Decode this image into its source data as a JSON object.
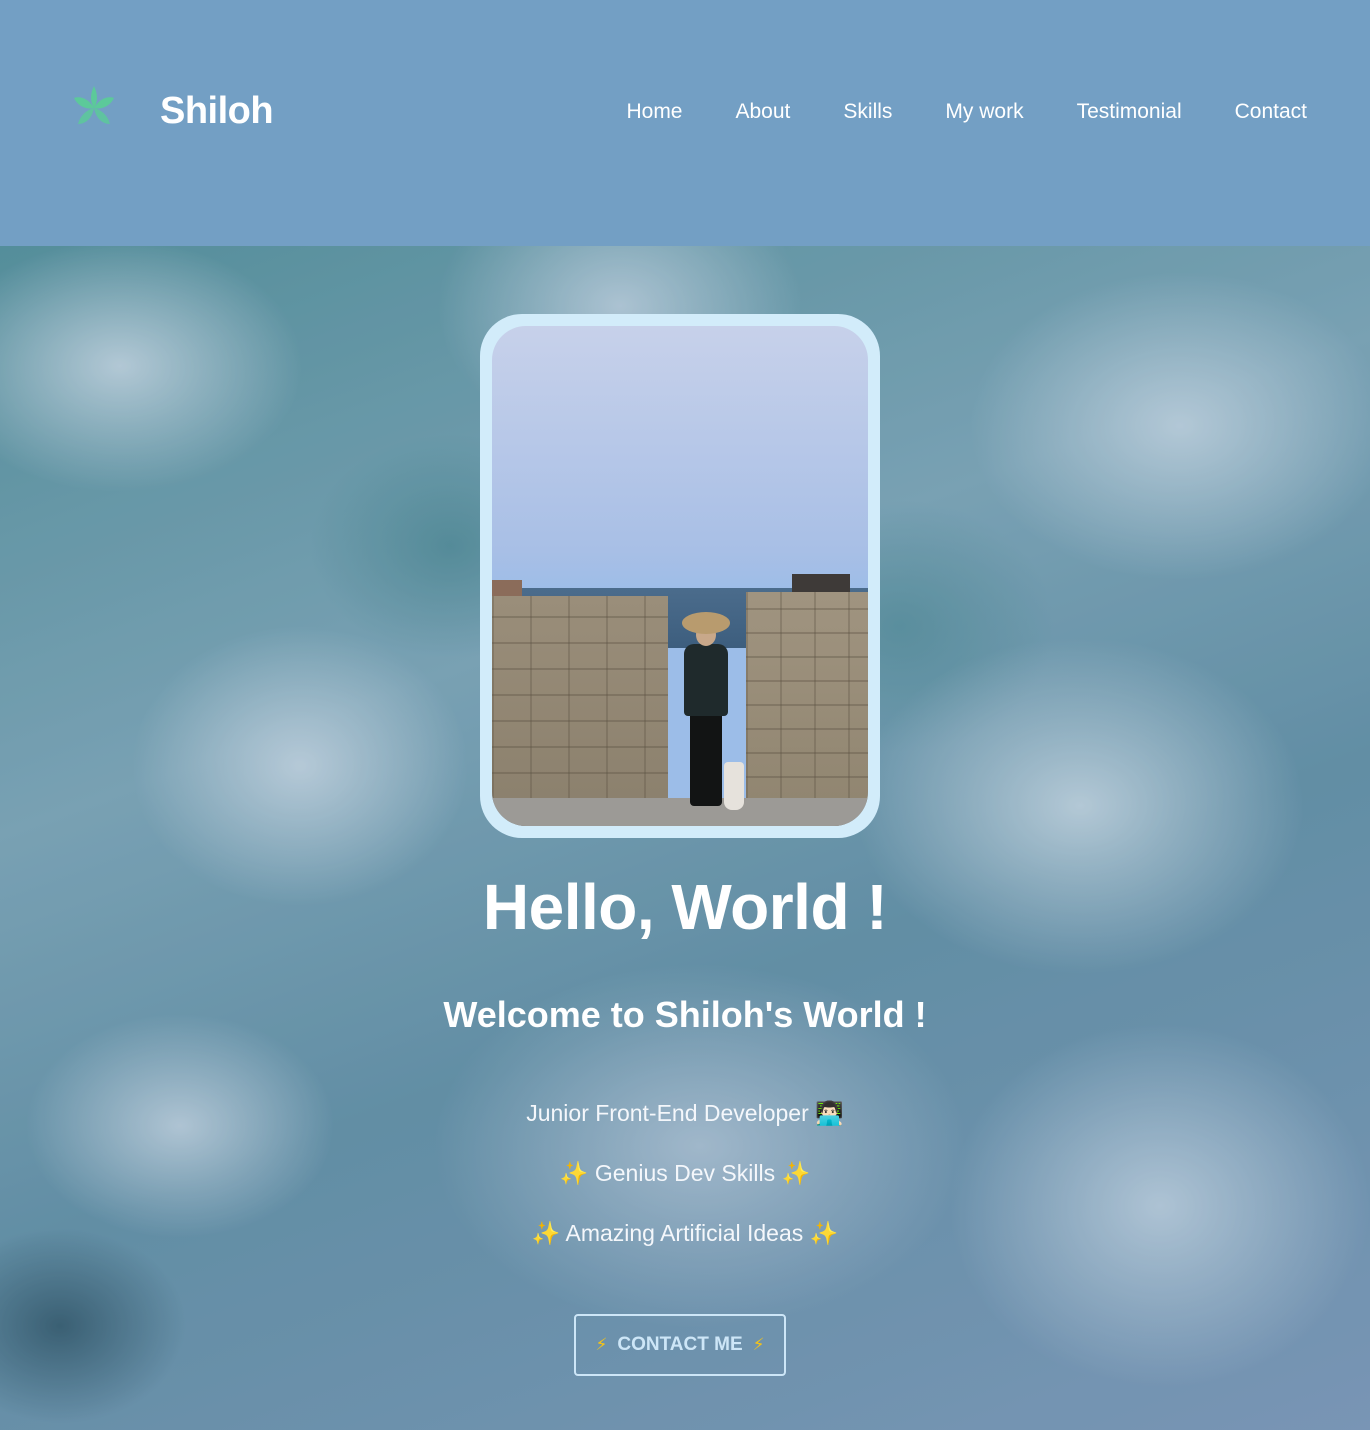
{
  "header": {
    "brand": "Shiloh",
    "logo_icon": "leaf-icon",
    "logo_color": "#5cc99a",
    "background": "#739fc4"
  },
  "nav": {
    "items": [
      {
        "label": "Home"
      },
      {
        "label": "About"
      },
      {
        "label": "Skills"
      },
      {
        "label": "My work"
      },
      {
        "label": "Testimonial"
      },
      {
        "label": "Contact"
      }
    ]
  },
  "hero": {
    "background_image": "ocean-foam-image",
    "profile_image": "profile-photo",
    "frame_color": "#d2ecfa",
    "greeting": "Hello, World !",
    "welcome": "Welcome to Shiloh's World !",
    "taglines": [
      "Junior Front-End Developer 👨🏻‍💻",
      "✨  Genius Dev Skills ✨",
      "✨  Amazing Artificial Ideas ✨"
    ],
    "contact_button": {
      "label": "CONTACT ME",
      "icon": "lightning-bolt-icon",
      "icon_glyph": "⚡"
    }
  }
}
